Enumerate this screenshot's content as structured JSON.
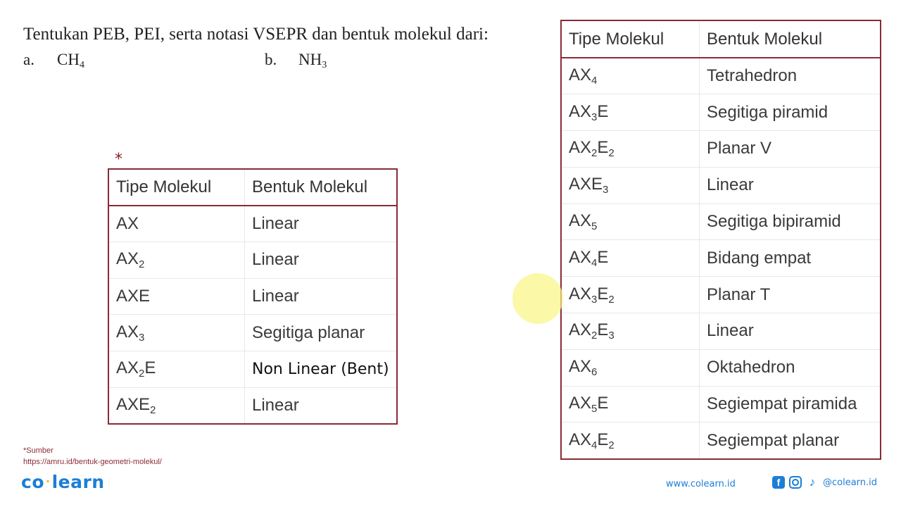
{
  "question": {
    "text": "Tentukan PEB, PEI, serta notasi VSEPR dan bentuk molekul dari:",
    "options": [
      {
        "label": "a.",
        "formula": "CH",
        "sub": "4"
      },
      {
        "label": "b.",
        "formula": "NH",
        "sub": "3"
      }
    ]
  },
  "asterisk": "*",
  "table_left": {
    "headers": [
      "Tipe Molekul",
      "Bentuk Molekul"
    ],
    "rows": [
      {
        "type_base": "AX",
        "type_html": "AX",
        "shape": "Linear"
      },
      {
        "type_html": "AX<sub>2</sub>",
        "shape": "Linear"
      },
      {
        "type_html": "AXE",
        "shape": "Linear"
      },
      {
        "type_html": "AX<sub>3</sub>",
        "shape": "Segitiga planar"
      },
      {
        "type_html": "AX<sub>2</sub>E",
        "shape": "Non Linear (Bent)"
      },
      {
        "type_html": "AXE<sub>2</sub>",
        "shape": "Linear"
      }
    ]
  },
  "table_right": {
    "headers": [
      "Tipe Molekul",
      "Bentuk Molekul"
    ],
    "rows": [
      {
        "type_html": "AX<sub>4</sub>",
        "shape": "Tetrahedron"
      },
      {
        "type_html": "AX<sub>3</sub>E",
        "shape": "Segitiga piramid"
      },
      {
        "type_html": "AX<sub>2</sub>E<sub>2</sub>",
        "shape": "Planar V"
      },
      {
        "type_html": "AXE<sub>3</sub>",
        "shape": "Linear"
      },
      {
        "type_html": "AX<sub>5</sub>",
        "shape": "Segitiga bipiramid"
      },
      {
        "type_html": "AX<sub>4</sub>E",
        "shape": "Bidang empat"
      },
      {
        "type_html": "AX<sub>3</sub>E<sub>2</sub>",
        "shape": "Planar T"
      },
      {
        "type_html": "AX<sub>2</sub>E<sub>3</sub>",
        "shape": "Linear"
      },
      {
        "type_html": "AX<sub>6</sub>",
        "shape": "Oktahedron"
      },
      {
        "type_html": "AX<sub>5</sub>E",
        "shape": "Segiempat piramida"
      },
      {
        "type_html": "AX<sub>4</sub>E<sub>2</sub>",
        "shape": "Segiempat planar"
      }
    ]
  },
  "source": {
    "label": "*Sumber",
    "url": "https://amru.id/bentuk-geometri-molekul/"
  },
  "branding": {
    "logo_left": "co",
    "logo_dot": "·",
    "logo_right": "learn",
    "website": "www.colearn.id",
    "social_icons": [
      "facebook-icon",
      "instagram-icon",
      "tiktok-icon"
    ],
    "handle": "@colearn.id",
    "accent_color": "#1c7ed6",
    "border_color": "#8b2a35"
  }
}
